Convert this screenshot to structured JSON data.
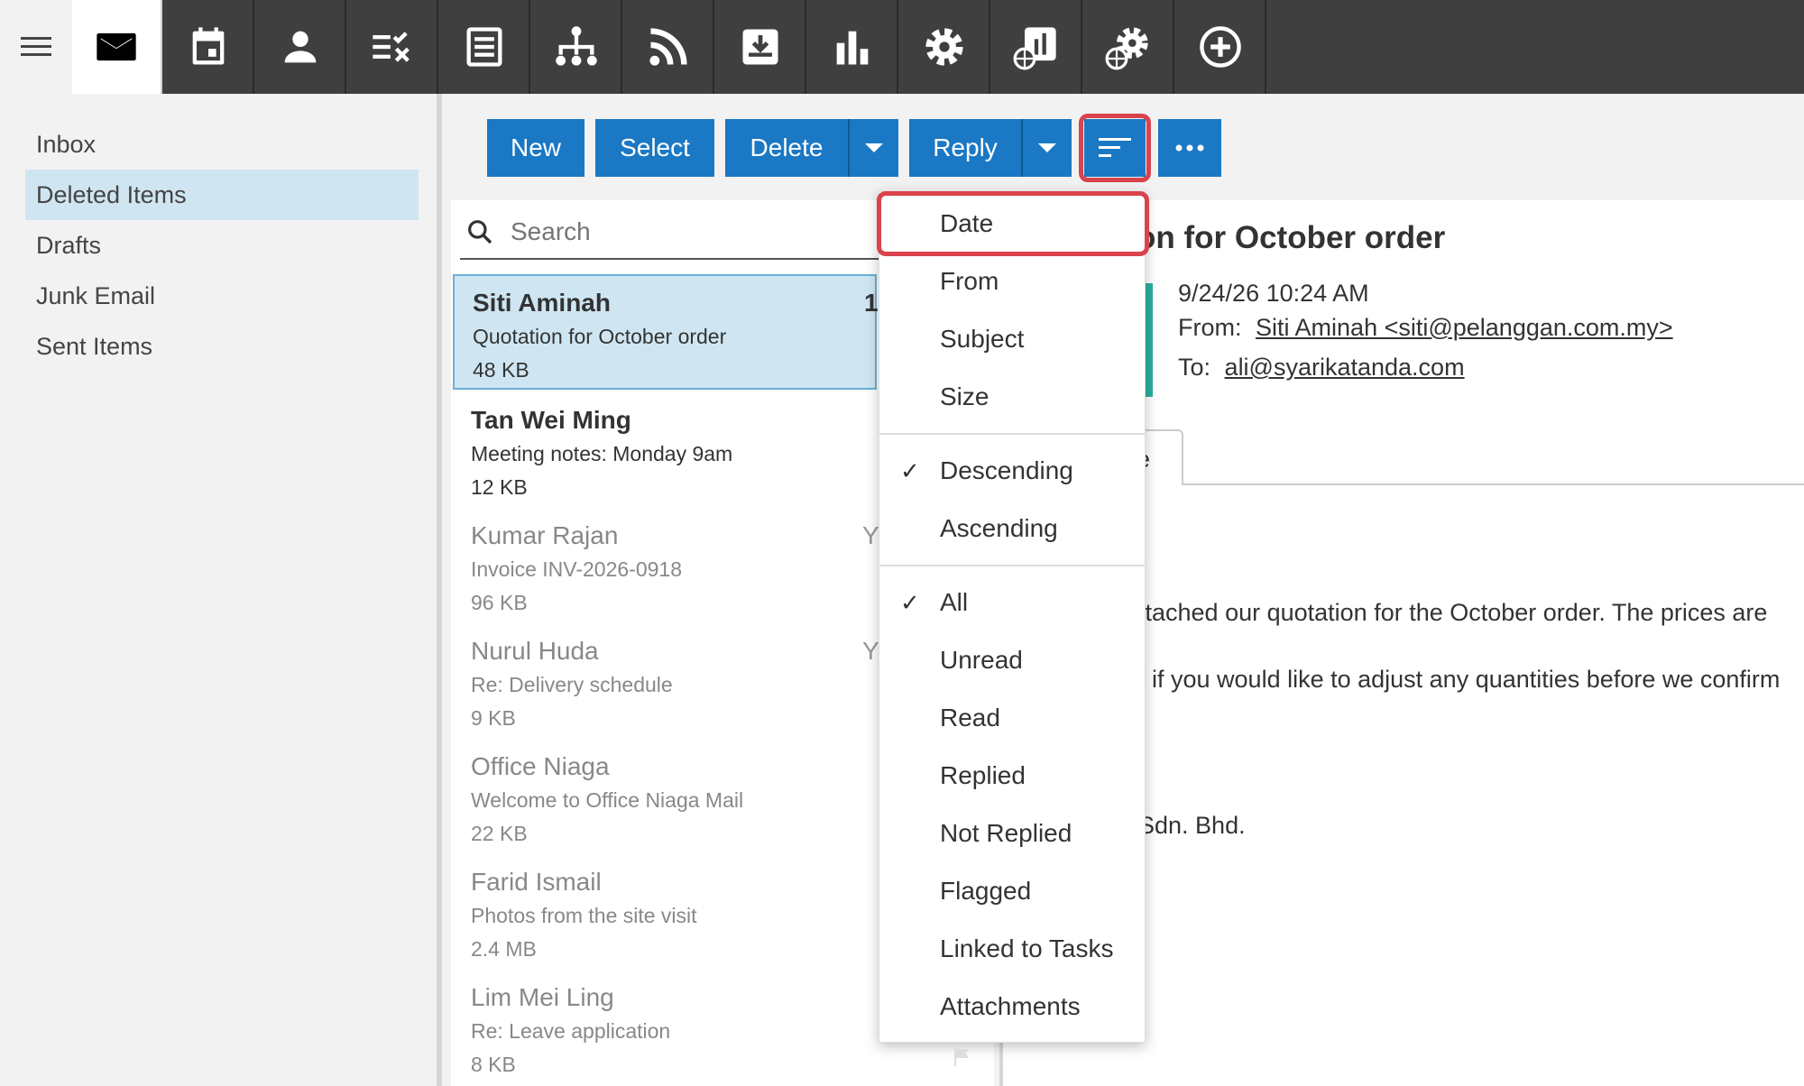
{
  "topbar": {
    "icons": [
      "menu-icon",
      "mail-icon",
      "calendar-icon",
      "contacts-icon",
      "tasks-icon",
      "notes-icon",
      "org-chart-icon",
      "rss-icon",
      "archive-icon",
      "reports-icon",
      "settings-icon",
      "web-reports-icon",
      "web-settings-icon",
      "add-icon"
    ]
  },
  "sidebar": {
    "folders": [
      "Inbox",
      "Deleted Items",
      "Drafts",
      "Junk Email",
      "Sent Items"
    ],
    "selected": "Deleted Items"
  },
  "toolbar": {
    "new_label": "New",
    "select_label": "Select",
    "delete_label": "Delete",
    "reply_label": "Reply"
  },
  "search": {
    "placeholder": "Search"
  },
  "messages": [
    {
      "from": "Siti Aminah",
      "subject": "Quotation for October order",
      "size": "48 KB",
      "date_fragment": "1",
      "state": "selected"
    },
    {
      "from": "Tan Wei Ming",
      "subject": "Meeting notes: Monday 9am",
      "size": "12 KB",
      "date_fragment": "",
      "state": "unread"
    },
    {
      "from": "Kumar Rajan",
      "subject": "Invoice INV-2026-0918",
      "size": "96 KB",
      "date_fragment": "Y",
      "state": "read"
    },
    {
      "from": "Nurul Huda",
      "subject": "Re: Delivery schedule",
      "size": "9 KB",
      "date_fragment": "Y",
      "state": "read"
    },
    {
      "from": "Office Niaga",
      "subject": "Welcome to Office Niaga Mail",
      "size": "22 KB",
      "date_fragment": "",
      "state": "read"
    },
    {
      "from": "Farid Ismail",
      "subject": "Photos from the site visit",
      "size": "2.4 MB",
      "date_fragment": "",
      "state": "read"
    },
    {
      "from": "Lim Mei Ling",
      "subject": "Re: Leave application",
      "size": "8 KB",
      "date_fragment": "",
      "state": "read"
    }
  ],
  "reading": {
    "title_visible": "on for October order",
    "date": "9/24/26 10:24 AM",
    "from_label": "From:",
    "from_value": "Siti Aminah <siti@pelanggan.com.my>",
    "to_label": "To:",
    "to_value": "ali@syarikatanda.com",
    "tab_fragment": "e",
    "body_lines": [
      "ttached our quotation for the October order. The prices are",
      "/ if you would like to adjust any quantities before we confirm",
      "Sdn. Bhd."
    ]
  },
  "sort_menu": {
    "sort_by": [
      "Date",
      "From",
      "Subject",
      "Size"
    ],
    "order": [
      {
        "label": "Descending",
        "checked": true
      },
      {
        "label": "Ascending",
        "checked": false
      }
    ],
    "filter": [
      {
        "label": "All",
        "checked": true
      },
      {
        "label": "Unread",
        "checked": false
      },
      {
        "label": "Read",
        "checked": false
      },
      {
        "label": "Replied",
        "checked": false
      },
      {
        "label": "Not Replied",
        "checked": false
      },
      {
        "label": "Flagged",
        "checked": false
      },
      {
        "label": "Linked to Tasks",
        "checked": false
      },
      {
        "label": "Attachments",
        "checked": false
      }
    ],
    "check_glyph": "✓"
  },
  "colors": {
    "accent_blue": "#1b78c4",
    "highlight_red": "#d9434b",
    "selection_blue": "#cfe6f2",
    "topbar": "#3f3f3f"
  }
}
